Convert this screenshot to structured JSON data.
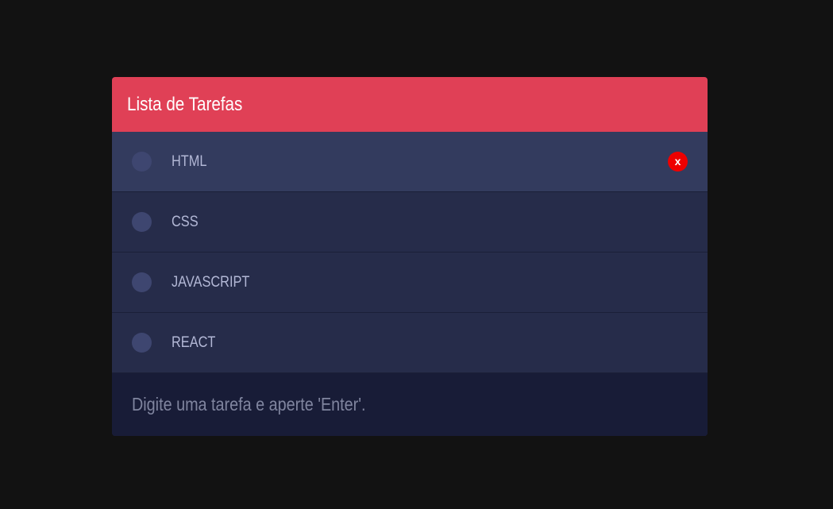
{
  "header": {
    "title": "Lista de Tarefas"
  },
  "tasks": [
    {
      "label": "HTML",
      "hovered": true,
      "delete_label": "x"
    },
    {
      "label": "CSS",
      "hovered": false
    },
    {
      "label": "JAVASCRIPT",
      "hovered": false
    },
    {
      "label": "REACT",
      "hovered": false
    }
  ],
  "input": {
    "value": "",
    "placeholder": "Digite uma tarefa e aperte 'Enter'."
  },
  "colors": {
    "page_background": "#121212",
    "header_background": "#e04056",
    "row_background": "#262c4a",
    "row_hover_background": "#333b5e",
    "input_background": "#181c37",
    "checkbox": "#3e4670",
    "delete_button": "#ee0000"
  }
}
